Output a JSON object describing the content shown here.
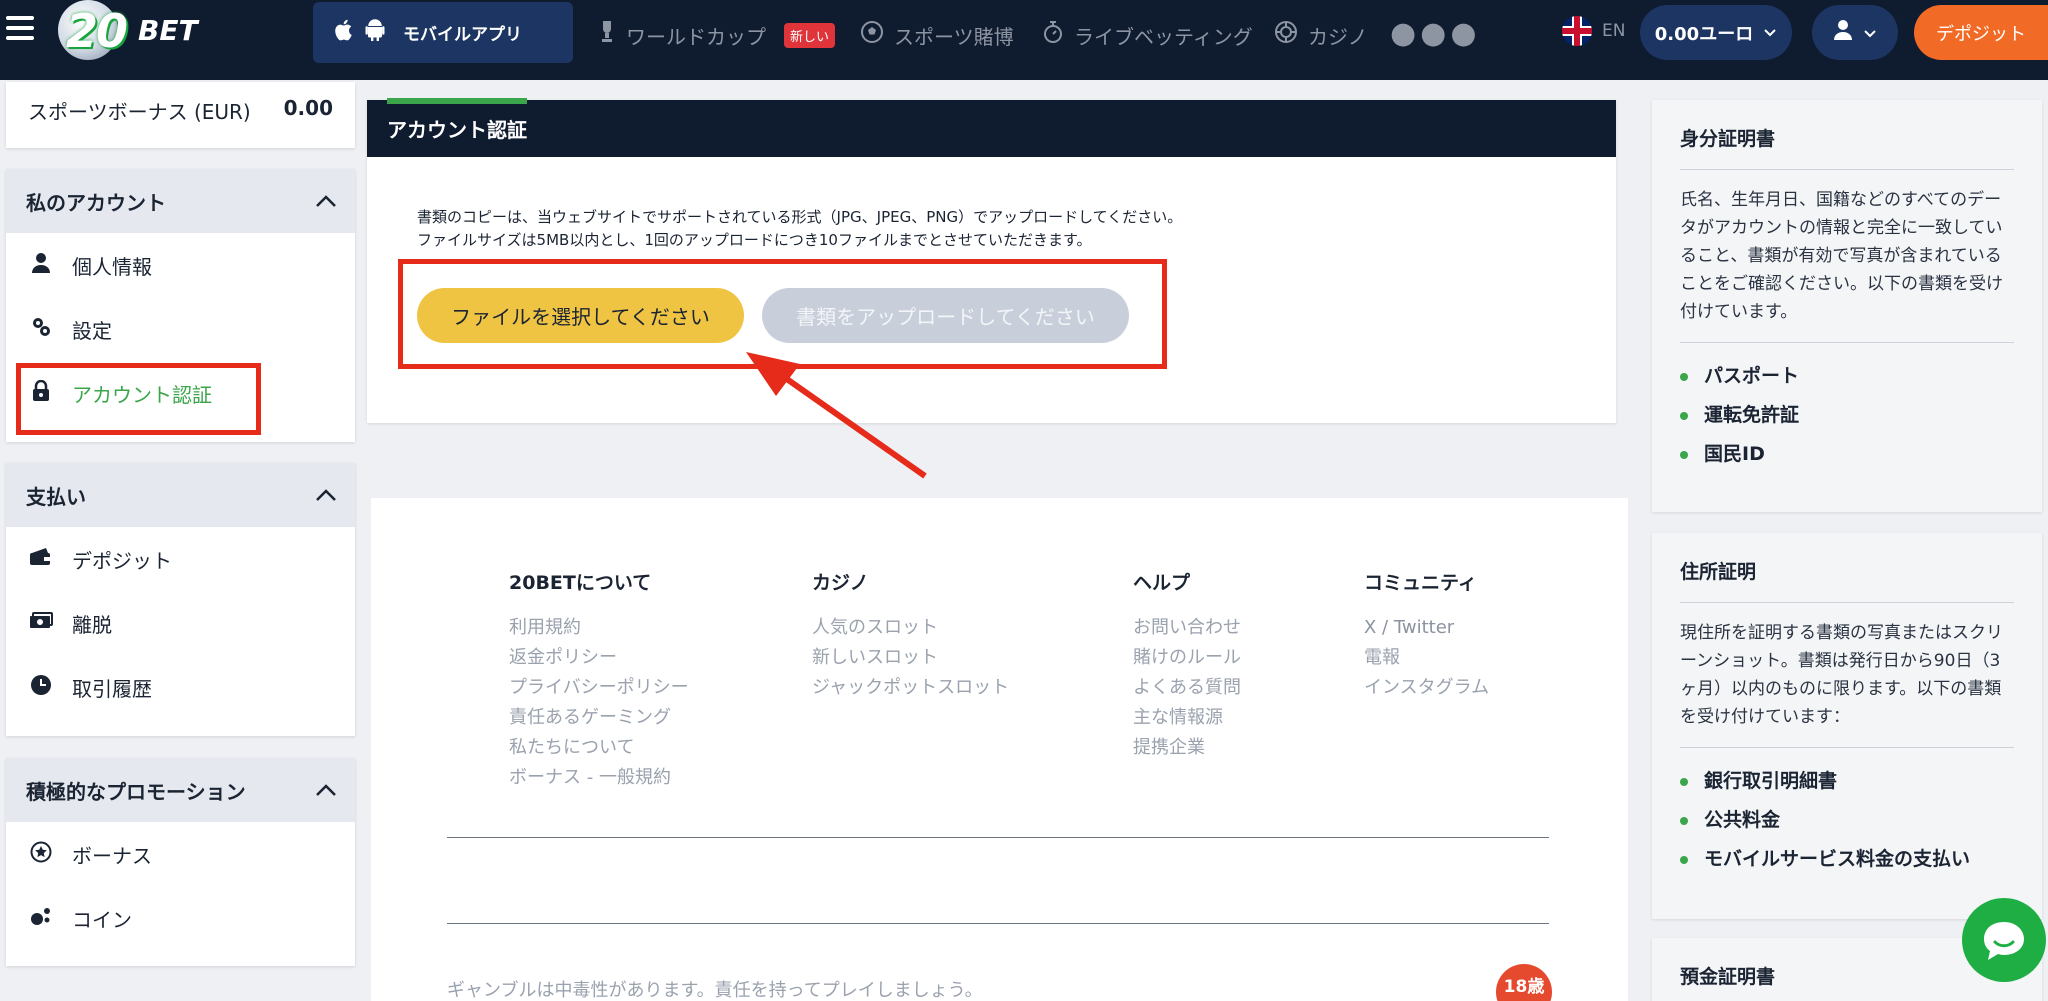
{
  "header": {
    "logo_number": "20",
    "logo_text": "BET",
    "mobile_app": "モバイルアプリ",
    "nav": [
      {
        "label": "ワールドカップ",
        "badge": "新しい",
        "icon": "trophy-icon"
      },
      {
        "label": "スポーツ賭博",
        "icon": "soccer-ball-icon"
      },
      {
        "label": "ライブベッティング",
        "icon": "stopwatch-icon"
      },
      {
        "label": "カジノ",
        "icon": "casino-chip-icon"
      }
    ],
    "more": "●●●",
    "language": "EN",
    "balance": "0.00ユーロ",
    "deposit": "デポジット"
  },
  "sidebar": {
    "sports_bonus_label": "スポーツボーナス (EUR)",
    "sports_bonus_value": "0.00",
    "sections": [
      {
        "title": "私のアカウント",
        "items": [
          {
            "label": "個人情報",
            "icon": "person-icon"
          },
          {
            "label": "設定",
            "icon": "settings-icon"
          },
          {
            "label": "アカウント認証",
            "icon": "lock-icon",
            "active": true
          }
        ]
      },
      {
        "title": "支払い",
        "items": [
          {
            "label": "デポジット",
            "icon": "wallet-icon"
          },
          {
            "label": "離脱",
            "icon": "cash-icon"
          },
          {
            "label": "取引履歴",
            "icon": "clock-icon"
          }
        ]
      },
      {
        "title": "積極的なプロモーション",
        "items": [
          {
            "label": "ボーナス",
            "icon": "star-icon"
          },
          {
            "label": "コイン",
            "icon": "coin-icon"
          }
        ]
      }
    ]
  },
  "main": {
    "title": "アカウント認証",
    "instruction_line1": "書類のコピーは、当ウェブサイトでサポートされている形式（JPG、JPEG、PNG）でアップロードしてください。",
    "instruction_line2": "ファイルサイズは5MB以内とし、1回のアップロードにつき10ファイルまでとさせていただきます。",
    "select_button": "ファイルを選択してください",
    "upload_button": "書類をアップロードしてください"
  },
  "footer": {
    "columns": [
      {
        "title": "20BETについて",
        "links": [
          "利用規約",
          "返金ポリシー",
          "プライバシーポリシー",
          "責任あるゲーミング",
          "私たちについて",
          "ボーナス - 一般規約"
        ]
      },
      {
        "title": "カジノ",
        "links": [
          "人気のスロット",
          "新しいスロット",
          "ジャックポットスロット"
        ]
      },
      {
        "title": "ヘルプ",
        "links": [
          "お問い合わせ",
          "賭けのルール",
          "よくある質問",
          "主な情報源",
          "提携企業"
        ]
      },
      {
        "title": "コミュニティ",
        "links": [
          "X / Twitter",
          "電報",
          "インスタグラム"
        ]
      }
    ],
    "gamble_notice": "ギャンブルは中毒性があります。責任を持ってプレイしましょう。",
    "age_badge": "18歳"
  },
  "right": {
    "id_card": {
      "title": "身分証明書",
      "desc": "氏名、生年月日、国籍などのすべてのデータがアカウントの情報と完全に一致していること、書類が有効で写真が含まれていることをご確認ください。以下の書類を受け付けています。",
      "items": [
        "パスポート",
        "運転免許証",
        "国民ID"
      ]
    },
    "address": {
      "title": "住所証明",
      "desc": "現住所を証明する書類の写真またはスクリーンショット。書類は発行日から90日（3ヶ月）以内のものに限ります。以下の書類を受け付けています：",
      "items": [
        "銀行取引明細書",
        "公共料金",
        "モバイルサービス料金の支払い"
      ]
    },
    "deposit_proof": {
      "title": "預金証明書"
    }
  },
  "colors": {
    "accent_green": "#3aa54a",
    "deposit_orange": "#f26b26",
    "navy": "#0f1b2f",
    "annotation_red": "#e62b1b",
    "select_yellow": "#f0c443"
  }
}
